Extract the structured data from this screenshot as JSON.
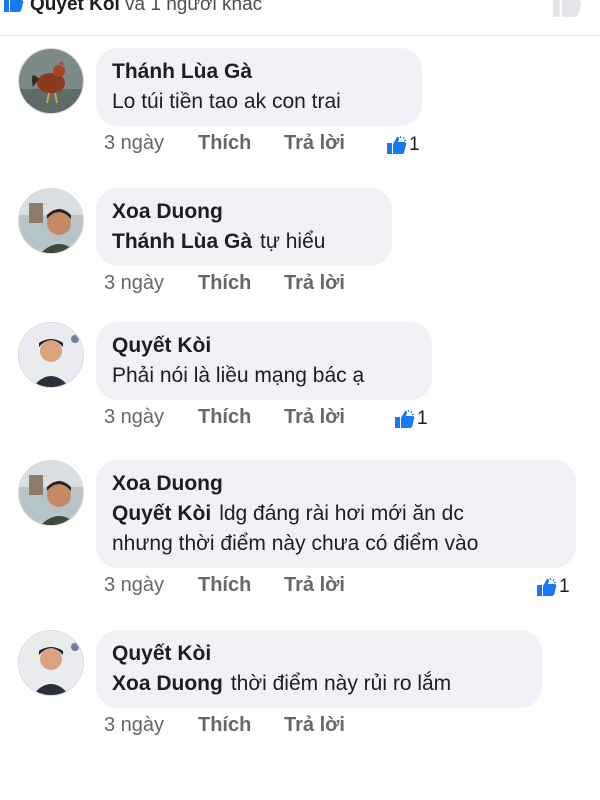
{
  "header": {
    "liker_name": "Quyết Kòi",
    "liker_suffix": "và 1 người khác"
  },
  "colors": {
    "like_blue": "#1877f2",
    "bubble_bg": "#f0f2f5",
    "meta_gray": "#65676b"
  },
  "comments": [
    {
      "author": "Thánh Lùa Gà",
      "mention": "",
      "text": "Lo túi tiền tao ak con trai",
      "text2": "",
      "time": "3 ngày",
      "like": "Thích",
      "reply": "Trả lời",
      "reactions": "1",
      "avatar": "rooster-photo"
    },
    {
      "author": "Xoa Duong",
      "mention": "Thánh Lùa Gà",
      "text": "tự hiểu",
      "text2": "",
      "time": "3 ngày",
      "like": "Thích",
      "reply": "Trả lời",
      "reactions": "",
      "avatar": "man-selfie-photo"
    },
    {
      "author": "Quyết Kòi",
      "mention": "",
      "text": "Phải nói là liều mạng bác ạ",
      "text2": "",
      "time": "3 ngày",
      "like": "Thích",
      "reply": "Trả lời",
      "reactions": "1",
      "avatar": "young-man-photo"
    },
    {
      "author": "Xoa Duong",
      "mention": "Quyết Kòi",
      "text": "ldg đáng rài hơi mới ăn dc",
      "text2": "nhưng thời điểm này chưa có điểm vào",
      "time": "3 ngày",
      "like": "Thích",
      "reply": "Trả lời",
      "reactions": "1",
      "avatar": "man-selfie-photo"
    },
    {
      "author": "Quyết Kòi",
      "mention": "Xoa Duong",
      "text": "thời điểm này rủi ro lắm",
      "text2": "",
      "time": "3 ngày",
      "like": "Thích",
      "reply": "Trả lời",
      "reactions": "",
      "avatar": "young-man-photo"
    }
  ]
}
